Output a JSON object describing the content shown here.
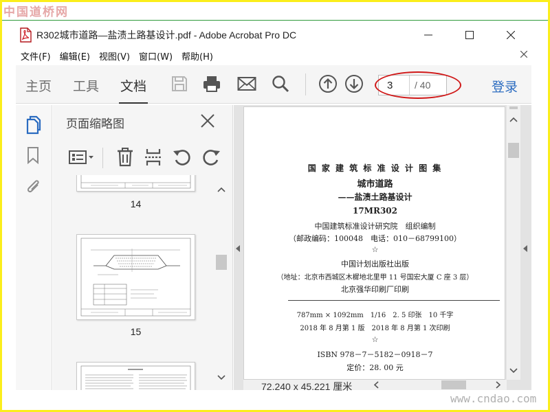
{
  "watermark": {
    "top": "中国道桥网",
    "bottom": "www.cndao.com"
  },
  "window": {
    "title": "R302城市道路—盐渍土路基设计.pdf - Adobe Acrobat Pro DC",
    "icons": {
      "minimize": "minimize-icon",
      "maximize": "maximize-icon",
      "close": "close-icon"
    }
  },
  "menu": {
    "items": [
      "文件(F)",
      "编辑(E)",
      "视图(V)",
      "窗口(W)",
      "帮助(H)"
    ],
    "close_icon": "close-icon"
  },
  "toolbar": {
    "tabs": [
      "主页",
      "工具",
      "文档"
    ],
    "active_tab": "文档",
    "icons": [
      "save-icon",
      "print-icon",
      "email-icon",
      "search-icon",
      "page-up-icon",
      "page-down-icon"
    ],
    "current_page": "3",
    "total_pages": "/ 40",
    "login": "登录",
    "highlight_color": "#d01818"
  },
  "left_rail": {
    "icons": [
      "page-thumbnails-icon",
      "bookmarks-icon",
      "attachments-icon"
    ],
    "accent": "#2a6bc0"
  },
  "thumbnail_panel": {
    "title": "页面缩略图",
    "tool_icons": [
      "thumbnail-options-icon",
      "delete-icon",
      "insert-page-icon",
      "rotate-left-icon",
      "rotate-right-icon"
    ],
    "pages": [
      {
        "label": "14"
      },
      {
        "label": "15"
      },
      {
        "label": ""
      }
    ]
  },
  "document": {
    "lines": [
      "国 家 建 筑 标 准 设 计 图 集",
      "城市道路",
      "——盐渍土路基设计",
      "17MR302",
      "中国建筑标准设计研究院　组织编制",
      "（邮政编码：100048　电话：010－68799100）",
      "☆",
      "中国计划出版社出版",
      "（地址：北京市西城区木樨地北里甲 11 号国宏大厦 C 座 3 层）",
      "北京强华印刷厂印刷",
      "787mm × 1092mm　1/16　2. 5 印张　10 千字",
      "2018 年 8 月第 1 版　2018 年 8 月第 1 次印刷",
      "☆",
      "ISBN 978－7－5182－0918－7",
      "定价：28. 00 元"
    ],
    "dimensions": "72.240 x 45.221 厘米"
  }
}
